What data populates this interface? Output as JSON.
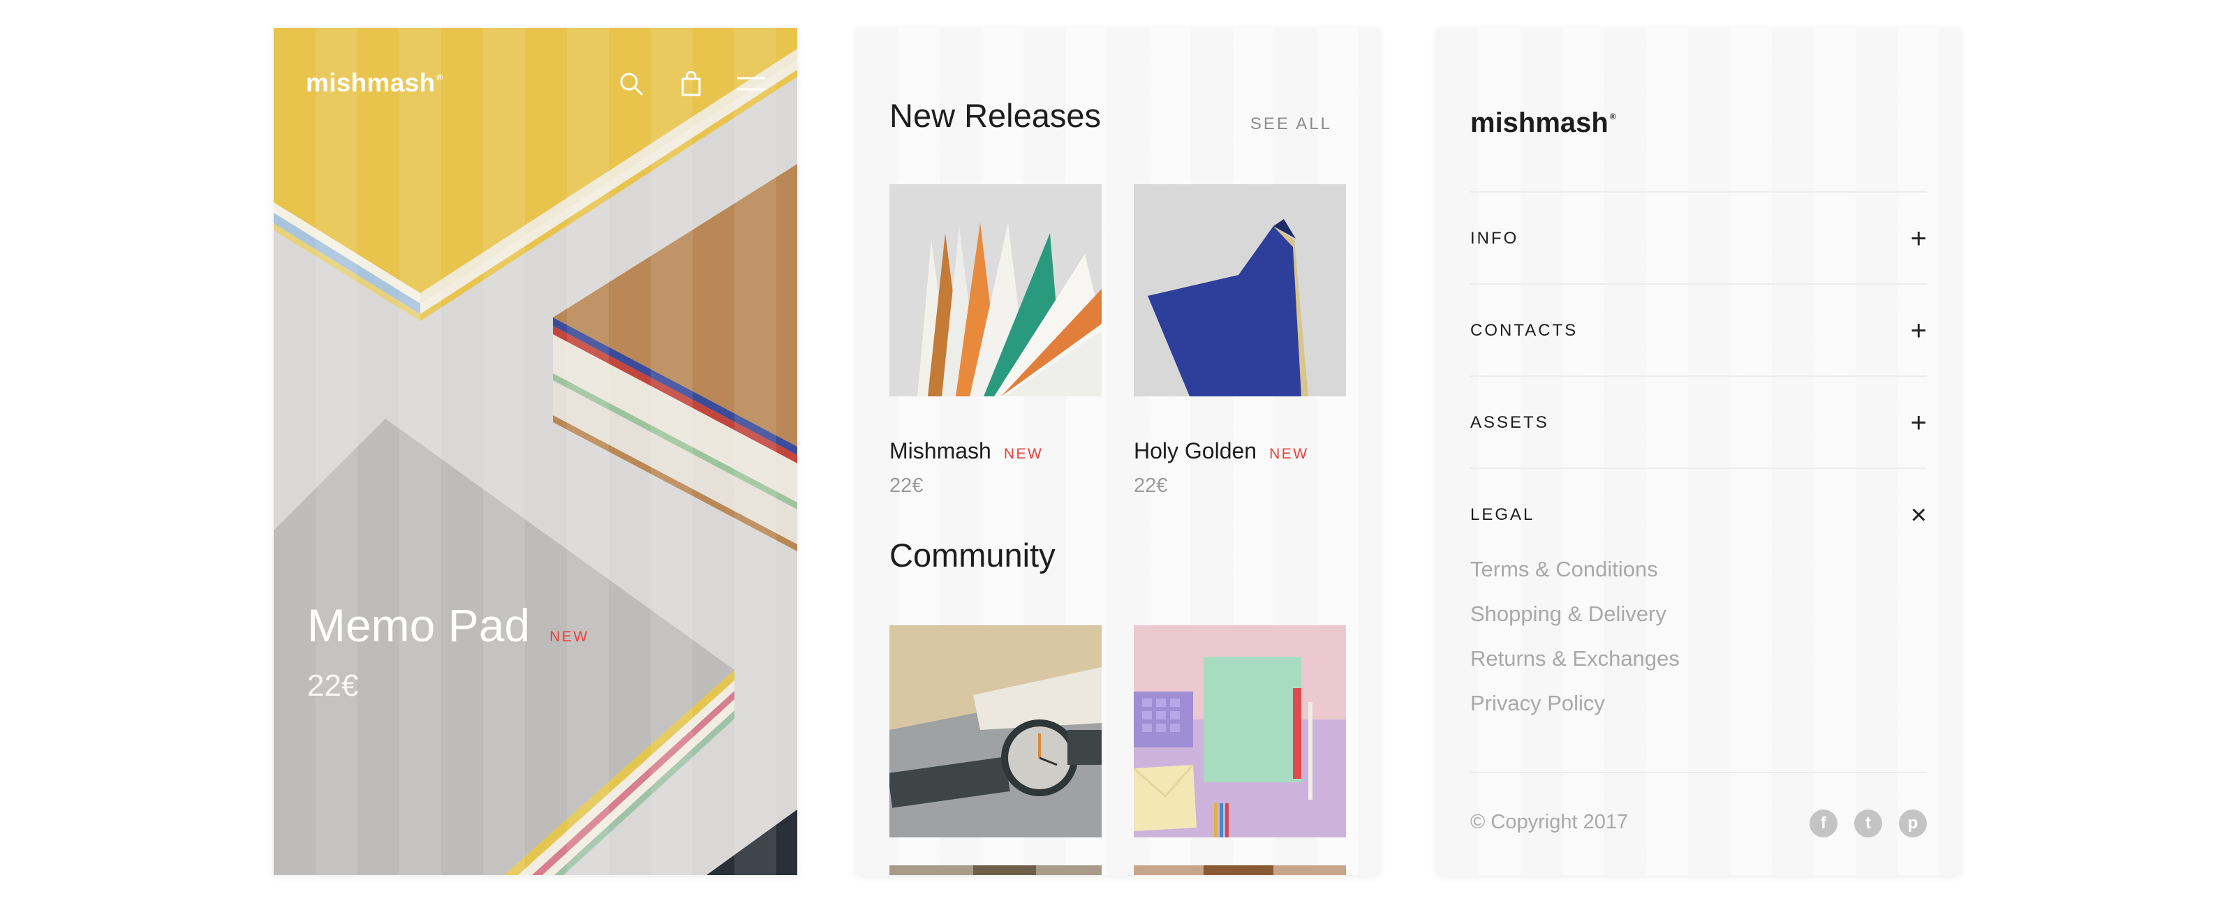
{
  "hero": {
    "brand": "mishmash",
    "brand_mark": "®",
    "icons": [
      "search-icon",
      "bag-icon",
      "menu-icon"
    ],
    "title": "Memo Pad",
    "badge": "NEW",
    "price": "22€"
  },
  "releases": {
    "title": "New Releases",
    "see_all": "SEE ALL",
    "items": [
      {
        "name": "Mishmash",
        "badge": "NEW",
        "price": "22€"
      },
      {
        "name": "Holy Golden",
        "badge": "NEW",
        "price": "22€"
      }
    ]
  },
  "community": {
    "title": "Community"
  },
  "menu": {
    "brand": "mishmash",
    "brand_mark": "®",
    "sections": [
      {
        "label": "INFO",
        "icon": "+"
      },
      {
        "label": "CONTACTS",
        "icon": "+"
      },
      {
        "label": "ASSETS",
        "icon": "+"
      },
      {
        "label": "LEGAL",
        "icon": "×"
      }
    ],
    "legal_links": [
      "Terms & Conditions",
      "Shopping & Delivery",
      "Returns & Exchanges",
      "Privacy Policy"
    ],
    "copyright": "© Copyright 2017",
    "social": [
      {
        "icon": "facebook-icon",
        "glyph": "f"
      },
      {
        "icon": "twitter-icon",
        "glyph": "t"
      },
      {
        "icon": "pinterest-icon",
        "glyph": "p"
      }
    ]
  },
  "colors": {
    "accent_new": "#e8403c",
    "muted_text": "#a9a9a9"
  }
}
